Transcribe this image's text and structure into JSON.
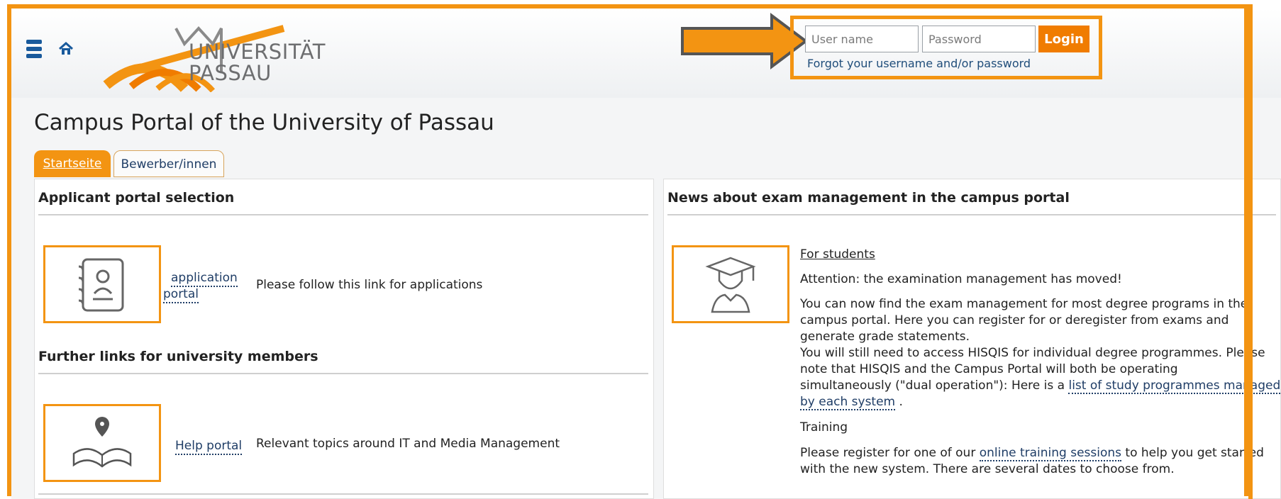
{
  "header": {
    "logo_line1": "UNIVERSITÄT",
    "logo_line2": "PASSAU",
    "login": {
      "username_placeholder": "User name",
      "password_placeholder": "Password",
      "login_label": "Login",
      "forgot_label": "Forgot your username and/or password"
    }
  },
  "page": {
    "title": "Campus Portal of the University of Passau",
    "tabs": [
      "Startseite",
      "Bewerber/innen"
    ]
  },
  "left_panel": {
    "section1_title": "Applicant portal selection",
    "app_link_line1": "application",
    "app_link_line2": "portal",
    "app_desc": "Please follow this link for applications",
    "section2_title": "Further links for university members",
    "help_link": "Help portal",
    "help_desc": "Relevant topics around IT and Media Management"
  },
  "right_panel": {
    "title": "News about exam management in the campus portal",
    "for_students": "For students",
    "attention": "Attention: the examination management has moved!",
    "para1_line1": "You can now find the exam management for most degree programs in the",
    "para1_line2": "campus portal. Here you can register for or deregister from exams and",
    "para1_line3": "generate grade statements.",
    "para2_line1": "You will still need to access HISQIS for individual degree programmes. Please",
    "para2_line2": "note that HISQIS and the Campus Portal will both be operating",
    "para2_line3_a": "simultaneously (\"dual operation\"): Here is a ",
    "para2_link_a": "list of study programmes managed",
    "para2_link_b": "by each system",
    "para2_end": " .",
    "training_title": "Training",
    "training_a": "Please register for one of our ",
    "training_link": "online training sessions",
    "training_b": " to help you get started",
    "training_c": "with the new system. There are several dates to choose from."
  },
  "colors": {
    "accent": "#f39412",
    "button": "#f07c00",
    "link": "#1f3d66",
    "blue_icon": "#195a9c"
  }
}
